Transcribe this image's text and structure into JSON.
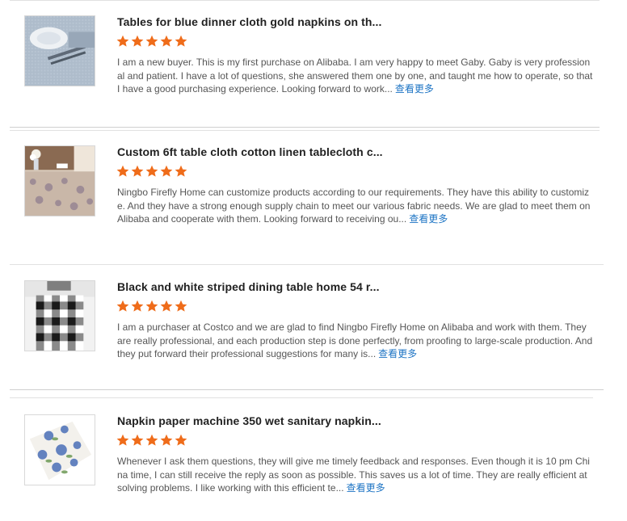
{
  "reviews": [
    {
      "title": "Tables for blue dinner cloth gold napkins on th...",
      "rating": 5,
      "text": "I am a new buyer. This is my first purchase on Alibaba. I am very happy to meet Gaby. Gaby is very professional and patient. I have a lot of questions, she answered them one by one, and taught me how to operate, so that I have a good purchasing experience. Looking forward to work...",
      "more_label": "查看更多"
    },
    {
      "title": "Custom 6ft table cloth cotton linen tablecloth c...",
      "rating": 5,
      "text": "Ningbo Firefly Home can customize products according to our requirements. They have this ability to customize. And they have a strong enough supply chain to meet our various fabric needs. We are glad to meet them on Alibaba and cooperate with them. Looking forward to receiving ou...",
      "more_label": "查看更多"
    },
    {
      "title": "Black and white striped dining table home 54 r...",
      "rating": 5,
      "text": "I am a purchaser at Costco and we are glad to find Ningbo Firefly Home on Alibaba and work with them. They are really professional, and each production step is done perfectly, from proofing to large-scale production. And they put forward their professional suggestions for many is...",
      "more_label": "查看更多"
    },
    {
      "title": "Napkin paper machine 350 wet sanitary napkin...",
      "rating": 5,
      "text": "Whenever I ask them questions, they will give me timely feedback and responses. Even though it is 10 pm China time, I can still receive the reply as soon as possible. This saves us a lot of time. They are really efficient at solving problems. I like working with this efficient te...",
      "more_label": "查看更多"
    }
  ],
  "colors": {
    "star": "#ef6c1a",
    "link": "#1d74c4",
    "title": "#222222",
    "body": "#555555"
  },
  "icons": [
    "star-icon"
  ]
}
